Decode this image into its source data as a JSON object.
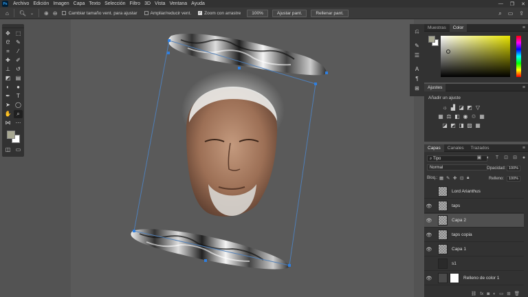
{
  "menu": [
    "Archivo",
    "Edición",
    "Imagen",
    "Capa",
    "Texto",
    "Selección",
    "Filtro",
    "3D",
    "Vista",
    "Ventana",
    "Ayuda"
  ],
  "options_bar": {
    "resize_windows_label": "Cambiar tamaño vent. para ajustar",
    "zoom_all_label": "Ampliar/reducir vent.",
    "scrubby_zoom_label": "Zoom con arrastre",
    "zoom_value": "100%",
    "fit_screen_label": "Ajustar pant.",
    "fill_screen_label": "Rellenar pant."
  },
  "color_panel": {
    "tabs": [
      "Muestras",
      "Color"
    ],
    "active_tab": "Color",
    "foreground": "#a8a892",
    "background": "#ffffff"
  },
  "adjustments_panel": {
    "tab": "Ajustes",
    "title": "Añadir un ajuste"
  },
  "layers_panel": {
    "tabs": [
      "Capas",
      "Canales",
      "Trazados"
    ],
    "active_tab": "Capas",
    "filter_kind": "Tipo",
    "blend_mode": "Normal",
    "opacity_label": "Opacidad:",
    "opacity_value": "100%",
    "lock_label": "Bloq.:",
    "fill_label": "Relleno:",
    "fill_value": "100%",
    "layers": [
      {
        "name": "Lord Arianthus",
        "visible": false,
        "selected": false,
        "thumb": "checker"
      },
      {
        "name": "taps",
        "visible": true,
        "selected": false,
        "thumb": "checker"
      },
      {
        "name": "Capa 2",
        "visible": true,
        "selected": true,
        "thumb": "checker"
      },
      {
        "name": "taps copia",
        "visible": true,
        "selected": false,
        "thumb": "checker"
      },
      {
        "name": "Capa 1",
        "visible": true,
        "selected": false,
        "thumb": "checker"
      },
      {
        "name": "s1",
        "visible": false,
        "selected": false,
        "thumb": "dark"
      },
      {
        "name": "Relleno de color 1",
        "visible": true,
        "selected": false,
        "thumb": "white"
      }
    ]
  },
  "document": {
    "background_color": "#5a5a5a"
  }
}
